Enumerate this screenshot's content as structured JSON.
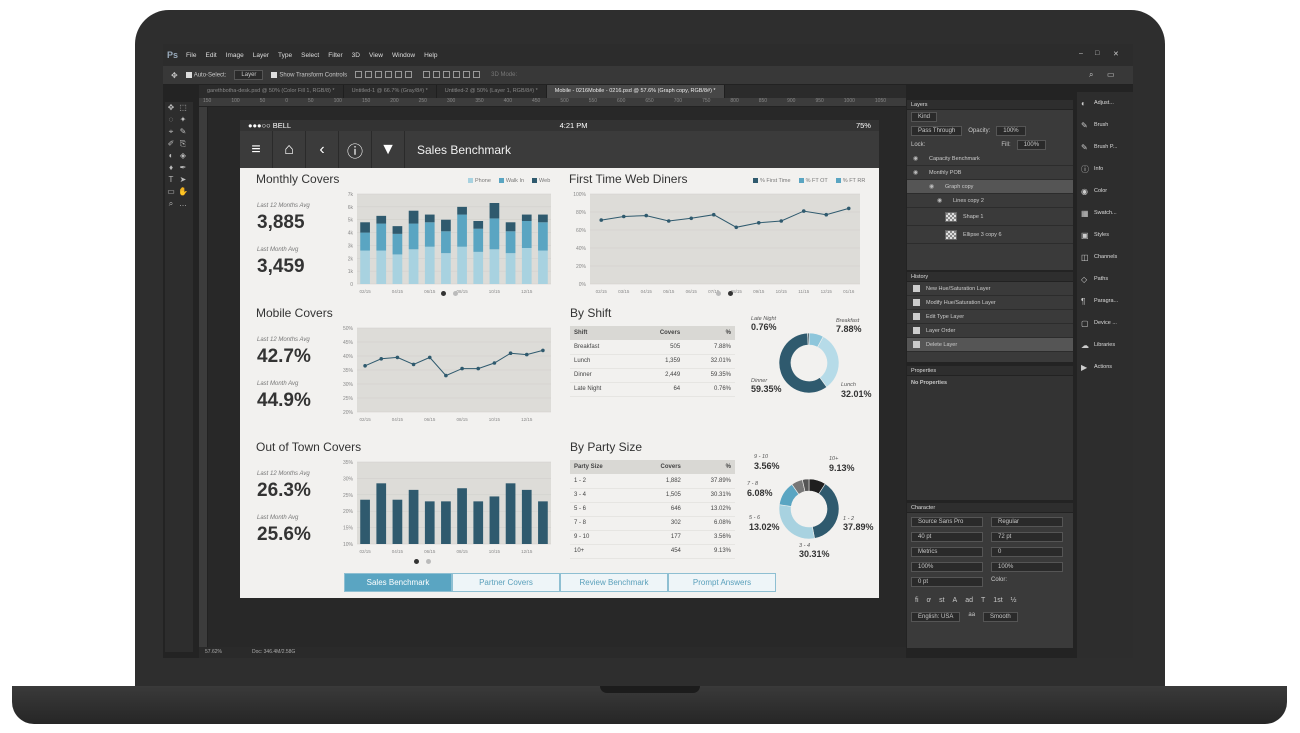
{
  "app": {
    "logo": "Ps",
    "menu": [
      "File",
      "Edit",
      "Image",
      "Layer",
      "Type",
      "Select",
      "Filter",
      "3D",
      "View",
      "Window",
      "Help"
    ],
    "window_controls": [
      "–",
      "□",
      "✕"
    ],
    "options": {
      "auto_select": "Auto-Select:",
      "layer_select": "Layer",
      "transform": "Show Transform Controls",
      "mode": "3D Mode:"
    },
    "tabs": [
      "garethbotha-desk.psd @ 50% (Color Fill 1, RGB/8) *",
      "Untitled-1 @ 66.7% (Gray/8#) *",
      "Untitled-2 @ 50% (Layer 1, RGB/8#) *",
      "Mobile - 0216Mobile - 0216.psd @ 57.6% (Graph copy, RGB/8#) *"
    ],
    "ruler": [
      "150",
      "100",
      "50",
      "0",
      "50",
      "100",
      "150",
      "200",
      "250",
      "300",
      "350",
      "400",
      "450",
      "500",
      "550",
      "600",
      "650",
      "700",
      "750",
      "800",
      "850",
      "900",
      "950",
      "1000",
      "1050",
      "1100",
      "1150",
      "1200",
      "1250",
      "1300",
      "1350",
      "1400"
    ],
    "status": {
      "zoom": "57.62%",
      "doc": "Doc: 346.4M/2.58G"
    }
  },
  "layers_panel": {
    "title": "Layers",
    "kind": "Kind",
    "blend": "Pass Through",
    "opacity_label": "Opacity:",
    "opacity": "100%",
    "lock_label": "Lock:",
    "fill_label": "Fill:",
    "fill": "100%",
    "items": [
      "Capacity Benchmark",
      "Monthly POB",
      "Graph copy",
      "Lines copy 2",
      "Shape 1",
      "Ellipse 3 copy 6"
    ]
  },
  "history_panel": {
    "title": "History",
    "items": [
      "New Hue/Saturation Layer",
      "Modify Hue/Saturation Layer",
      "Edit Type Layer",
      "Layer Order",
      "Delete Layer"
    ]
  },
  "properties_panel": {
    "title": "Properties",
    "text": "No Properties"
  },
  "character_panel": {
    "title": "Character",
    "font": "Source Sans Pro",
    "style": "Regular",
    "size": "40 pt",
    "leading": "72 pt",
    "kerning": "Metrics",
    "tracking": "0",
    "vscale": "100%",
    "hscale": "100%",
    "baseline": "0 pt",
    "color_label": "Color:",
    "glyphs": [
      "fi",
      "ơ",
      "st",
      "A",
      "ad",
      "T",
      "1st",
      "½"
    ],
    "language": "English: USA",
    "aa": "aa",
    "smooth": "Smooth"
  },
  "right_dock": [
    "Adjust...",
    "Brush",
    "Brush P...",
    "Info",
    "Color",
    "Swatch...",
    "Styles",
    "Channels",
    "Paths",
    "Paragra...",
    "Device ...",
    "Libraries",
    "Actions"
  ],
  "device": {
    "carrier": "●●●○○ BELL",
    "time": "4:21 PM",
    "battery": "75%"
  },
  "nav": {
    "title": "Sales Benchmark"
  },
  "monthly": {
    "title": "Monthly Covers",
    "legend": [
      "Phone",
      "Walk In",
      "Web"
    ],
    "avg12_label": "Last 12 Months Avg",
    "avg12": "3,885",
    "avgm_label": "Last Month Avg",
    "avgm": "3,459"
  },
  "first_time": {
    "title": "First Time Web Diners",
    "legend": [
      "% First Time",
      "% FT OT",
      "% FT RR"
    ]
  },
  "mobile": {
    "title": "Mobile Covers",
    "avg12_label": "Last 12 Months Avg",
    "avg12": "42.7%",
    "avgm_label": "Last Month Avg",
    "avgm": "44.9%"
  },
  "out_of_town": {
    "title": "Out of Town Covers",
    "avg12_label": "Last 12 Months Avg",
    "avg12": "26.3%",
    "avgm_label": "Last Month Avg",
    "avgm": "25.6%"
  },
  "by_shift": {
    "title": "By Shift",
    "headers": [
      "Shift",
      "Covers",
      "%"
    ],
    "rows": [
      [
        "Breakfast",
        "505",
        "7.88%"
      ],
      [
        "Lunch",
        "1,359",
        "32.01%"
      ],
      [
        "Dinner",
        "2,449",
        "59.35%"
      ],
      [
        "Late Night",
        "64",
        "0.76%"
      ]
    ],
    "labels": {
      "late_night": "Late Night",
      "late_night_v": "0.76%",
      "breakfast": "Breakfast",
      "breakfast_v": "7.88%",
      "dinner": "Dinner",
      "dinner_v": "59.35%",
      "lunch": "Lunch",
      "lunch_v": "32.01%"
    }
  },
  "by_party": {
    "title": "By Party Size",
    "headers": [
      "Party Size",
      "Covers",
      "%"
    ],
    "rows": [
      [
        "1 - 2",
        "1,882",
        "37.89%"
      ],
      [
        "3 - 4",
        "1,505",
        "30.31%"
      ],
      [
        "5 - 6",
        "646",
        "13.02%"
      ],
      [
        "7 - 8",
        "302",
        "6.08%"
      ],
      [
        "9 - 10",
        "177",
        "3.56%"
      ],
      [
        "10+",
        "454",
        "9.13%"
      ]
    ],
    "labels": {
      "p910": "9 - 10",
      "p910_v": "3.56%",
      "p10": "10+",
      "p10_v": "9.13%",
      "p78": "7 - 8",
      "p78_v": "6.08%",
      "p56": "5 - 6",
      "p56_v": "13.02%",
      "p12": "1 - 2",
      "p12_v": "37.89%",
      "p34": "3 - 4",
      "p34_v": "30.31%"
    }
  },
  "bottom_tabs": [
    "Sales Benchmark",
    "Partner Covers",
    "Review Benchmark",
    "Prompt Answers"
  ],
  "chart_data": [
    {
      "type": "bar",
      "title": "Monthly Covers",
      "categories": [
        "02/15",
        "03/15",
        "04/15",
        "05/15",
        "06/15",
        "07/15",
        "08/15",
        "09/15",
        "10/15",
        "11/15",
        "12/15",
        "01/16"
      ],
      "xticks": [
        "02/15",
        "04/15",
        "06/15",
        "08/15",
        "10/15",
        "12/15"
      ],
      "ylim": [
        0,
        7000
      ],
      "yticks": [
        "0",
        "1k",
        "2k",
        "3k",
        "4k",
        "5k",
        "6k",
        "7k"
      ],
      "series": [
        {
          "name": "Phone",
          "values": [
            2600,
            2600,
            2300,
            2700,
            2900,
            2400,
            2900,
            2500,
            2700,
            2400,
            2800,
            2600
          ]
        },
        {
          "name": "Walk In",
          "values": [
            1400,
            2100,
            1600,
            2000,
            1900,
            1700,
            2500,
            1800,
            2400,
            1700,
            2100,
            2200
          ]
        },
        {
          "name": "Web",
          "values": [
            800,
            600,
            600,
            1000,
            600,
            900,
            600,
            600,
            1200,
            700,
            500,
            600
          ]
        }
      ],
      "colors": [
        "#a8d2e0",
        "#5aa5c2",
        "#2f5a6e"
      ]
    },
    {
      "type": "line",
      "title": "First Time Web Diners",
      "x": [
        "02/15",
        "03/15",
        "04/15",
        "05/15",
        "06/15",
        "07/15",
        "08/15",
        "09/15",
        "10/15",
        "11/15",
        "12/15",
        "01/16"
      ],
      "xticks": [
        "02/15",
        "03/15",
        "04/15",
        "05/15",
        "06/15",
        "07/15",
        "08/15",
        "09/15",
        "10/15",
        "11/15",
        "12/15",
        "01/16"
      ],
      "ylim": [
        0,
        100
      ],
      "yticks": [
        "0%",
        "20%",
        "40%",
        "60%",
        "80%",
        "100%"
      ],
      "values": [
        71,
        75,
        76,
        70,
        73,
        77,
        63,
        68,
        70,
        81,
        77,
        84
      ]
    },
    {
      "type": "line",
      "title": "Mobile Covers",
      "x": [
        "02/15",
        "03/15",
        "04/15",
        "05/15",
        "06/15",
        "07/15",
        "08/15",
        "09/15",
        "10/15",
        "11/15",
        "12/15",
        "01/16"
      ],
      "xticks": [
        "02/15",
        "04/15",
        "06/15",
        "08/15",
        "10/15",
        "12/15"
      ],
      "ylim": [
        20,
        50
      ],
      "yticks": [
        "20%",
        "25%",
        "30%",
        "35%",
        "40%",
        "45%",
        "50%"
      ],
      "values": [
        36.5,
        39,
        39.5,
        37,
        39.5,
        33,
        35.5,
        35.5,
        37.5,
        41,
        40.5,
        42
      ]
    },
    {
      "type": "bar",
      "title": "Out of Town Covers",
      "categories": [
        "02/15",
        "03/15",
        "04/15",
        "05/15",
        "06/15",
        "07/15",
        "08/15",
        "09/15",
        "10/15",
        "11/15",
        "12/15",
        "01/16"
      ],
      "xticks": [
        "02/15",
        "04/15",
        "06/15",
        "08/15",
        "10/15",
        "12/15"
      ],
      "ylim": [
        10,
        35
      ],
      "yticks": [
        "10%",
        "15%",
        "20%",
        "25%",
        "30%",
        "35%"
      ],
      "values": [
        23.5,
        28.5,
        23.5,
        26.5,
        23,
        23,
        27,
        23,
        24.5,
        28.5,
        26.5,
        23
      ]
    },
    {
      "type": "pie",
      "title": "By Shift",
      "labels": [
        "Breakfast",
        "Lunch",
        "Dinner",
        "Late Night"
      ],
      "values": [
        7.88,
        32.01,
        59.35,
        0.76
      ],
      "colors": [
        "#8ec6db",
        "#b6dbe8",
        "#2f5a6e",
        "#1d3a48"
      ]
    },
    {
      "type": "pie",
      "title": "By Party Size",
      "labels": [
        "10+",
        "1 - 2",
        "3 - 4",
        "5 - 6",
        "7 - 8",
        "9 - 10"
      ],
      "values": [
        9.13,
        37.89,
        30.31,
        13.02,
        6.08,
        3.56
      ],
      "colors": [
        "#1f1f1f",
        "#2f5a6e",
        "#a8d2e0",
        "#5aa5c2",
        "#777777",
        "#555555"
      ]
    }
  ]
}
